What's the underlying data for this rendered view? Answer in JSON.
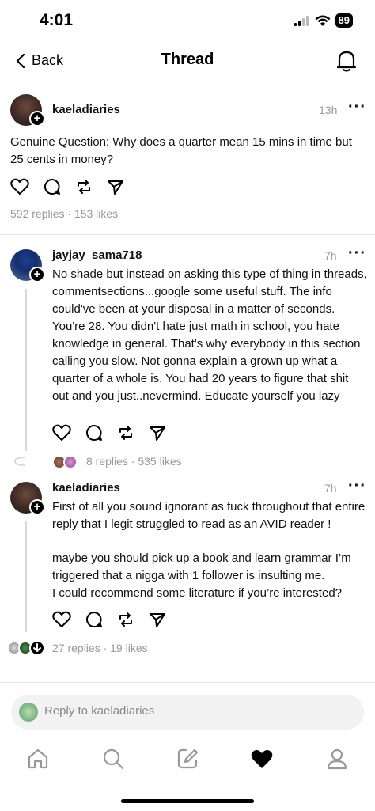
{
  "status": {
    "time": "4:01",
    "battery": "89"
  },
  "nav": {
    "back_label": "Back",
    "title": "Thread"
  },
  "op": {
    "username": "kaeladiaries",
    "time": "13h",
    "text": "Genuine Question: Why does a quarter mean 15 mins in time but 25 cents in money?",
    "meta": "592 replies · 153 likes"
  },
  "replies": [
    {
      "username": "jayjay_sama718",
      "time": "7h",
      "text": "No shade but instead on asking this type of thing in threads, commentsections...google some useful stuff. The info could've been at your disposal in a matter of seconds. You're 28. You didn't hate just math in school, you hate knowledge in general. That's why everybody in this section calling you slow. Not gonna explain a grown up what a quarter of a whole is. You had 20 years to figure that shit out and you just..nevermind. Educate yourself you lazy",
      "meta": "8 replies · 535 likes"
    },
    {
      "username": "kaeladiaries",
      "time": "7h",
      "text1": "First of all you sound ignorant as fuck throughout that entire reply that I legit struggled to read as an AVID reader !",
      "text2": "maybe you should pick up a book and learn grammar I’m triggered that a nigga with 1 follower is insulting me.",
      "text3": "I could recommend some literature if you’re interested?",
      "meta": "27 replies · 19 likes"
    }
  ],
  "reply_bar": {
    "placeholder": "Reply to kaeladiaries"
  },
  "tabs": [
    "home-icon",
    "search-icon",
    "compose-icon",
    "heart-icon",
    "profile-icon"
  ]
}
